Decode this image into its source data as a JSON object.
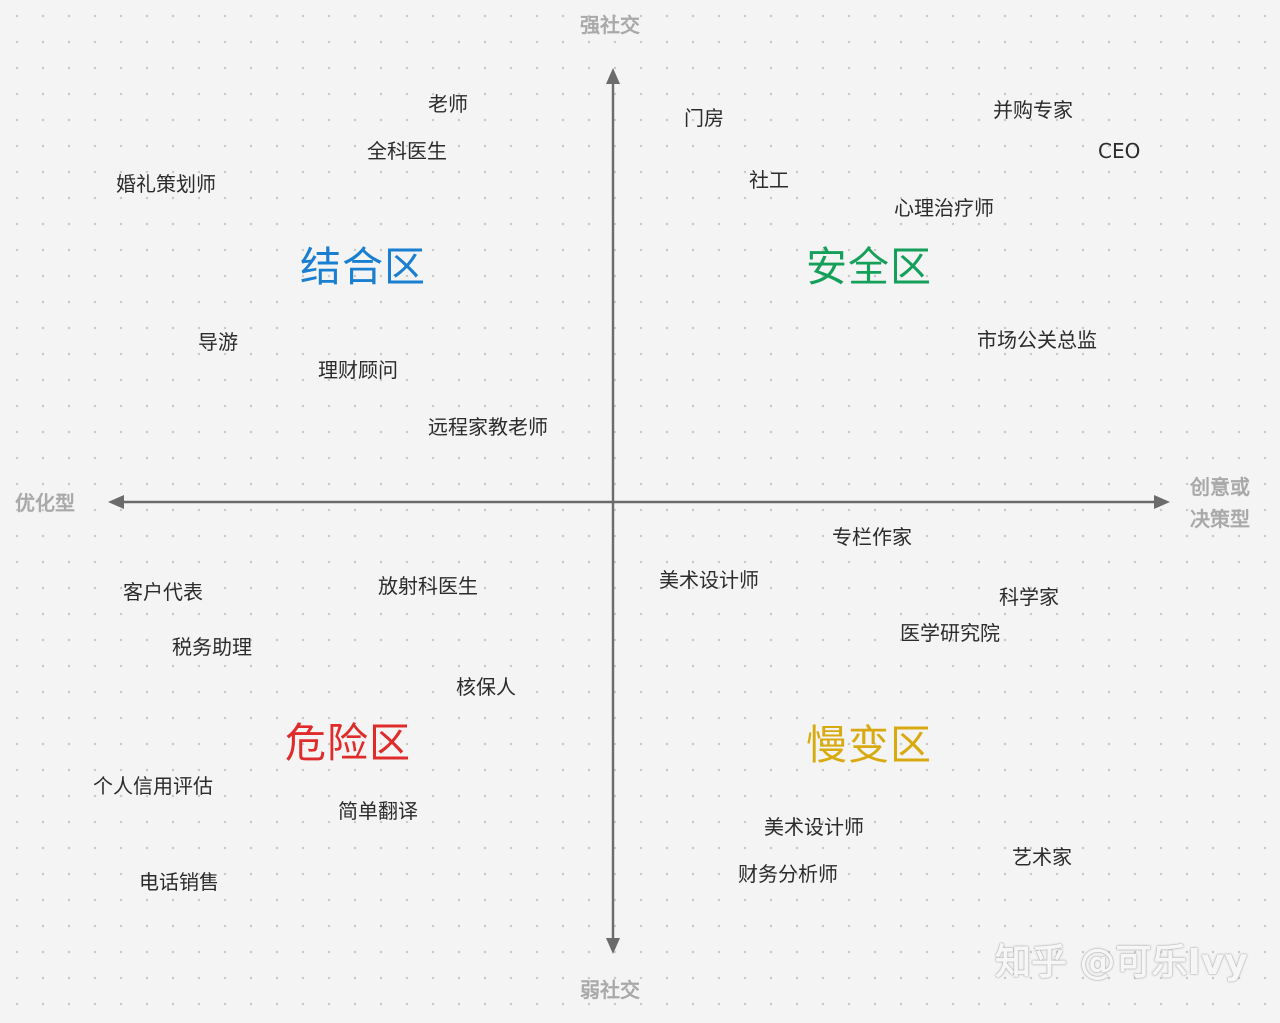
{
  "axes": {
    "top": "强社交",
    "bottom": "弱社交",
    "left": "优化型",
    "right_line1": "创意或",
    "right_line2": "决策型",
    "color": "#6b6b6b"
  },
  "zones": {
    "top_left": {
      "label": "结合区",
      "color": "#1a7fd1"
    },
    "top_right": {
      "label": "安全区",
      "color": "#14a05a"
    },
    "bottom_left": {
      "label": "危险区",
      "color": "#e02b2b"
    },
    "bottom_right": {
      "label": "慢变区",
      "color": "#d9aa10"
    }
  },
  "jobs": {
    "top_left": [
      "老师",
      "全科医生",
      "婚礼策划师",
      "导游",
      "理财顾问",
      "远程家教老师"
    ],
    "top_right": [
      "门房",
      "并购专家",
      "CEO",
      "社工",
      "心理治疗师",
      "市场公关总监"
    ],
    "bottom_left": [
      "客户代表",
      "放射科医生",
      "税务助理",
      "核保人",
      "个人信用评估",
      "简单翻译",
      "电话销售"
    ],
    "bottom_right": [
      "专栏作家",
      "美术设计师",
      "科学家",
      "医学研究院",
      "美术设计师",
      "艺术家",
      "财务分析师"
    ]
  },
  "watermark": "知乎 @可乐Ivy"
}
